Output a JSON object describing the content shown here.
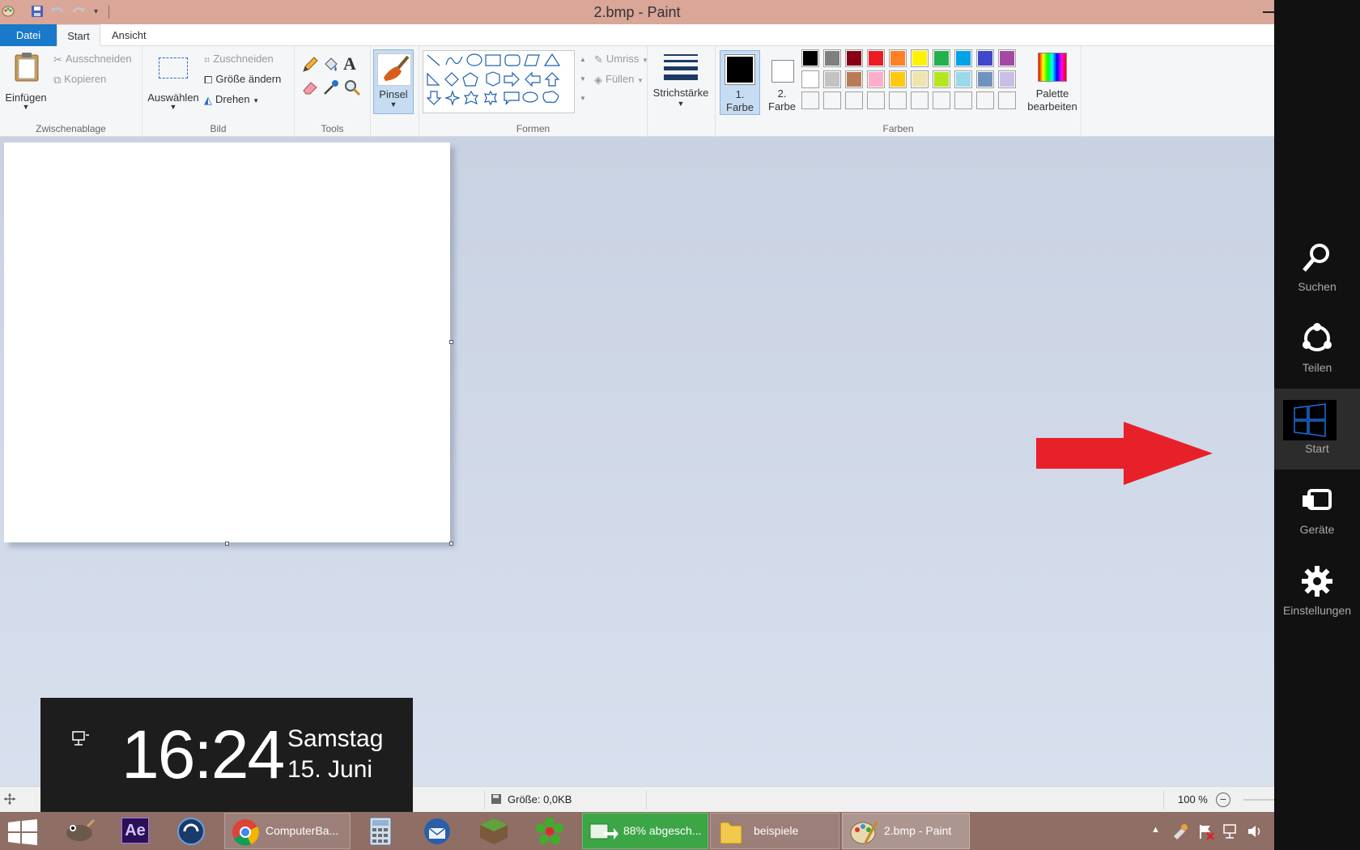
{
  "window": {
    "title": "2.bmp - Paint"
  },
  "tabs": {
    "datei": "Datei",
    "start": "Start",
    "ansicht": "Ansicht"
  },
  "ribbon": {
    "clipboard": {
      "paste": "Einfügen",
      "cut": "Ausschneiden",
      "copy": "Kopieren",
      "label": "Zwischenablage"
    },
    "image": {
      "select": "Auswählen",
      "crop": "Zuschneiden",
      "resize": "Größe ändern",
      "rotate": "Drehen",
      "label": "Bild"
    },
    "tools": {
      "label": "Tools"
    },
    "brushes": {
      "label": "Pinsel"
    },
    "shapes": {
      "outline": "Umriss",
      "fill": "Füllen",
      "label": "Formen"
    },
    "stroke": {
      "label": "Strichstärke"
    },
    "colors": {
      "color1": "1.",
      "color1b": "Farbe",
      "color2": "2.",
      "color2b": "Farbe",
      "edit_palette": "Palette",
      "edit_palette_b": "bearbeiten",
      "label": "Farben",
      "palette_row1": [
        "#000000",
        "#7f7f7f",
        "#880015",
        "#ed1c24",
        "#ff7f27",
        "#fff200",
        "#22b14c",
        "#00a2e8",
        "#3f48cc",
        "#a349a4"
      ],
      "palette_row2": [
        "#ffffff",
        "#c3c3c3",
        "#b97a57",
        "#ffaec9",
        "#ffc90e",
        "#efe4b0",
        "#b5e61d",
        "#99d9ea",
        "#7092be",
        "#c8bfe7"
      ]
    }
  },
  "statusbar": {
    "size": "Größe: 0,0KB",
    "zoom": "100 %"
  },
  "clock": {
    "time": "16:24",
    "day": "Samstag",
    "date": "15. Juni"
  },
  "taskbar": {
    "chrome": "ComputerBa...",
    "download": "88% abgesch...",
    "explorer": "beispiele",
    "paint": "2.bmp - Paint"
  },
  "charms": {
    "search": "Suchen",
    "share": "Teilen",
    "start": "Start",
    "devices": "Geräte",
    "settings": "Einstellungen"
  },
  "colors": {
    "accent": "#1979ca",
    "arrow": "#e8202a",
    "titlebar": "#d9a698",
    "charms_bg": "#111111"
  }
}
